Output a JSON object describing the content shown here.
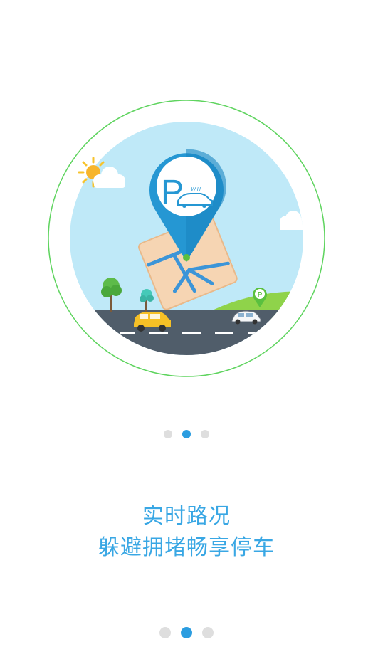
{
  "slide": {
    "title": "实时路况",
    "subtitle": "躲避拥堵畅享停车"
  },
  "pagination": {
    "total": 3,
    "active_index": 1
  },
  "illustration": {
    "pin_letter": "P",
    "pin_plate": "W H",
    "small_pin_letter": "P"
  },
  "colors": {
    "accent": "#2b9de0",
    "caption": "#39a7e4",
    "ring": "#5fd45f",
    "sky": "#bfe9f8",
    "road": "#505d6a"
  }
}
